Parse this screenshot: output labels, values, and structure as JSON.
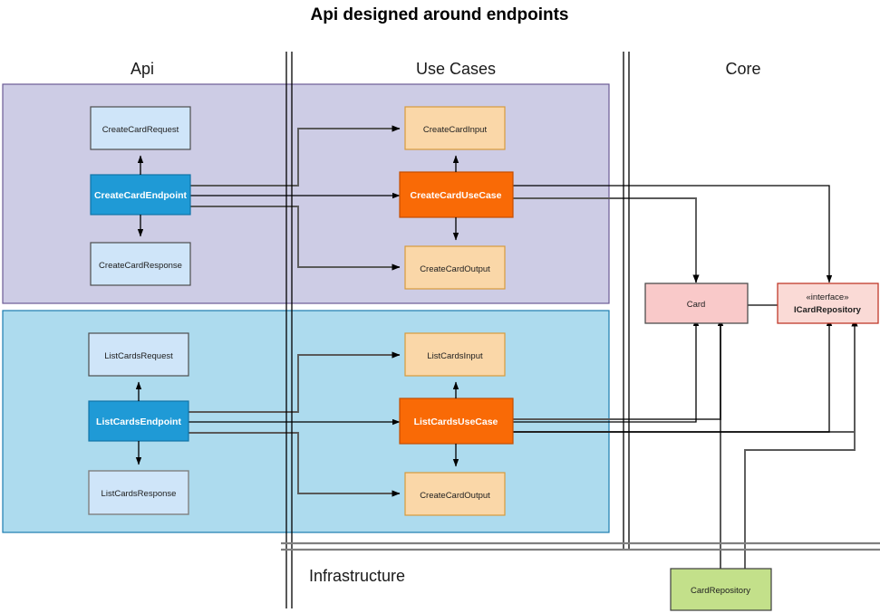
{
  "title": "Api designed around endpoints",
  "columns": {
    "api": "Api",
    "use_cases": "Use Cases",
    "core": "Core"
  },
  "infrastructure_label": "Infrastructure",
  "groups": [
    {
      "id": "create-card-group",
      "name": "create-card-group",
      "color": "#cdcce5"
    },
    {
      "id": "list-cards-group",
      "name": "list-cards-group",
      "color": "#addbee"
    }
  ],
  "nodes": {
    "create_card_request": "CreateCardRequest",
    "create_card_endpoint": "CreateCardEndpoint",
    "create_card_response": "CreateCardResponse",
    "create_card_input": "CreateCardInput",
    "create_card_usecase": "CreateCardUseCase",
    "create_card_output": "CreateCardOutput",
    "list_cards_request": "ListCardsRequest",
    "list_cards_endpoint": "ListCardsEndpoint",
    "list_cards_response": "ListCardsResponse",
    "list_cards_input": "ListCardsInput",
    "list_cards_usecase": "ListCardsUseCase",
    "list_cards_output": "CreateCardOutput",
    "card": "Card",
    "icard_repository_stereotype": "«interface»",
    "icard_repository": "ICardRepository",
    "card_repository": "CardRepository"
  },
  "colors": {
    "endpoint": "#1f9ad6",
    "usecase": "#f96a06",
    "request_response": "#cfe5f9",
    "input_output": "#fad7a8",
    "entity": "#f9c9c9",
    "interface": "#fadad6",
    "repository": "#c3e08a",
    "group_create": "#cdcce5",
    "group_list": "#addbee"
  }
}
